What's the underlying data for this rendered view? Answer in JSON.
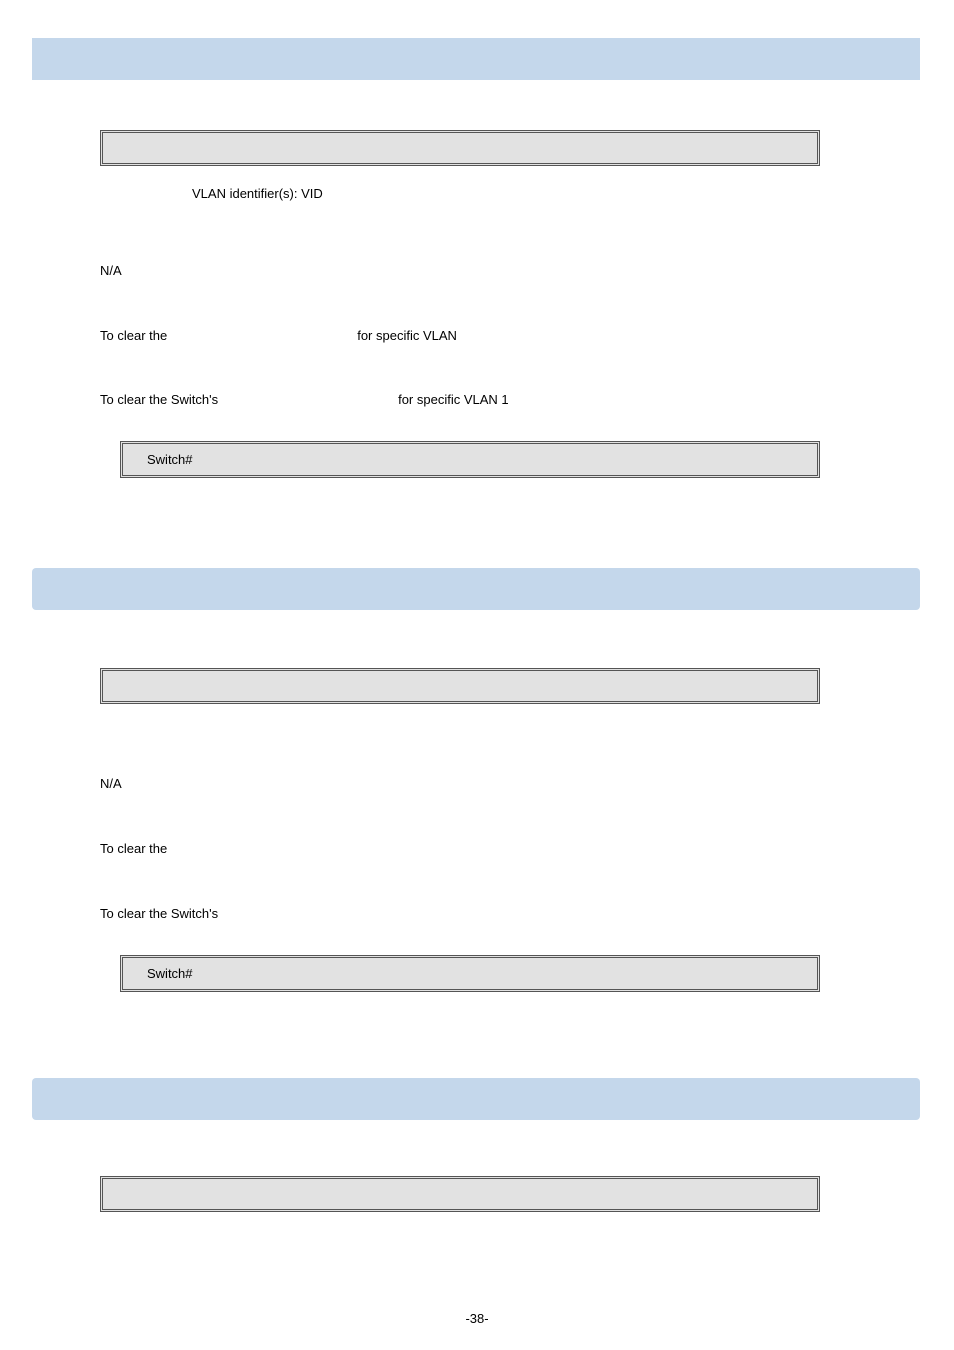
{
  "section1": {
    "header": "",
    "syntax_box": "",
    "param_line": "VLAN identifier(s): VID",
    "default_label": "N/A",
    "usage_prefix": "To clear the",
    "usage_suffix": "for specific VLAN",
    "example_prefix": "To clear the Switch's",
    "example_suffix": "for specific VLAN 1",
    "prompt": "Switch#"
  },
  "section2": {
    "header": "",
    "syntax_box": "",
    "default_label": "N/A",
    "usage_prefix": "To clear the",
    "example_prefix": "To clear the Switch's",
    "prompt": "Switch#"
  },
  "section3": {
    "header": "",
    "syntax_box": ""
  },
  "page_number": "-38-"
}
